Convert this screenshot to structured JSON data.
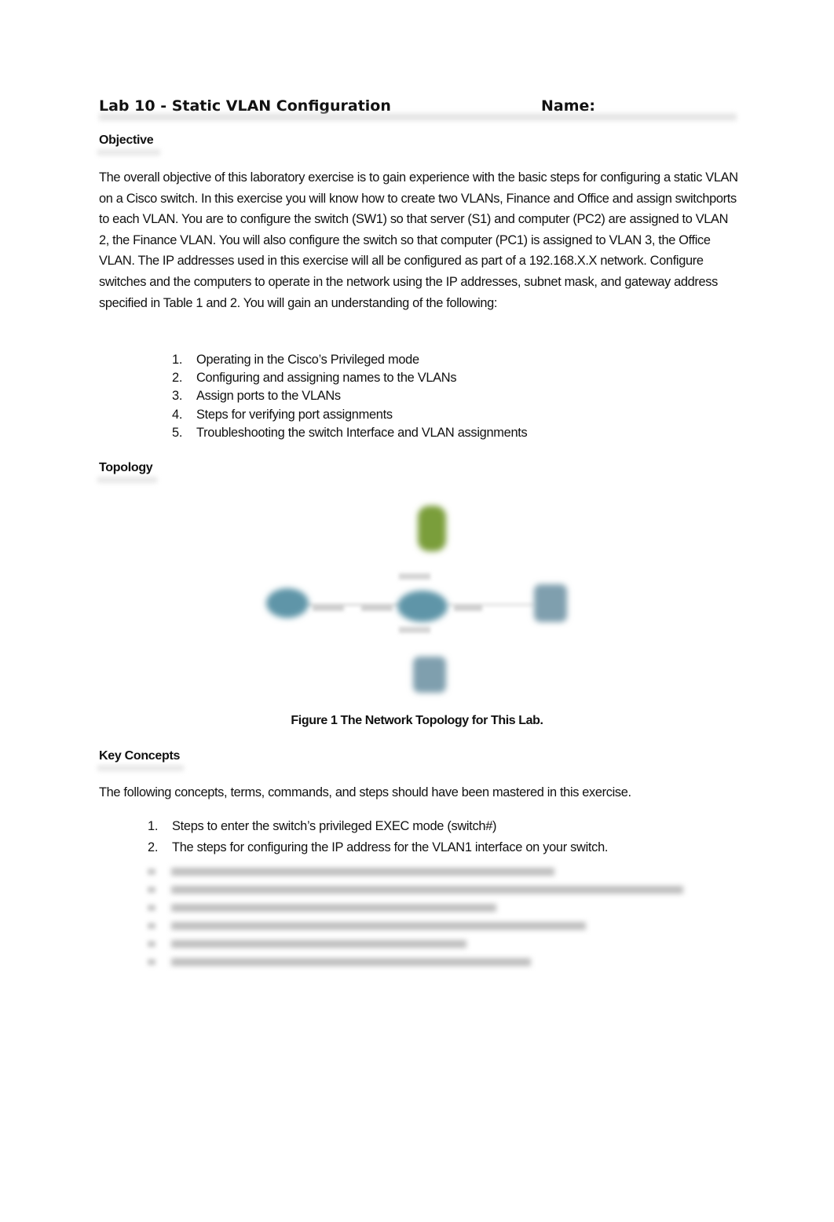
{
  "document": {
    "title": "Lab 10 - Static VLAN Configuration",
    "name_label": "Name:",
    "sections": {
      "objective": {
        "heading": "Objective",
        "paragraph": "The overall objective of this laboratory exercise is to gain experience with the basic steps for configuring a static VLAN on a Cisco switch.  In this exercise you will know how to create two VLANs, Finance and Office and assign switchports to each VLAN.  You are to configure the switch (SW1) so that server (S1) and computer (PC2) are assigned to VLAN 2, the Finance VLAN. You will also configure the switch so that computer (PC1) is assigned to VLAN 3, the Office VLAN. The IP addresses used in this exercise will all be configured as part of a 192.168.X.X network.  Configure switches and the computers to operate in the network using the IP addresses, subnet mask, and gateway address specified in Table 1 and 2. You will gain an understanding of the following:",
        "items": [
          {
            "num": "1.",
            "text": "Operating in the Cisco’s Privileged mode"
          },
          {
            "num": "2.",
            "text": "Configuring and assigning names to the VLANs"
          },
          {
            "num": "3.",
            "text": "Assign ports to the VLANs"
          },
          {
            "num": "4.",
            "text": "Steps for verifying port assignments"
          },
          {
            "num": "5.",
            "text": "Troubleshooting the switch  Interface and VLAN assignments"
          }
        ]
      },
      "topology": {
        "heading": "Topology",
        "figure_caption": "Figure 1  The Network Topology for This Lab.",
        "nodes": [
          {
            "id": "server",
            "icon": "server-icon",
            "color": "#7a9e3a"
          },
          {
            "id": "left-device",
            "icon": "router-icon",
            "color": "#5e95a8"
          },
          {
            "id": "switch",
            "icon": "switch-icon",
            "color": "#5e95a8"
          },
          {
            "id": "right-pc",
            "icon": "computer-icon",
            "color": "#7f9fae"
          },
          {
            "id": "bottom-pc",
            "icon": "computer-icon",
            "color": "#7f9fae"
          }
        ]
      },
      "key_concepts": {
        "heading": "Key Concepts",
        "intro": "The following concepts, terms, commands, and steps should have been mastered in this exercise.",
        "items": [
          {
            "num": "1.",
            "text": "Steps to enter the switch’s privileged EXEC mode (switch#)"
          },
          {
            "num": "2.",
            "text": "The steps for configuring the IP address for the VLAN1 interface on your switch."
          }
        ],
        "obscured_item_count": 6
      }
    }
  }
}
